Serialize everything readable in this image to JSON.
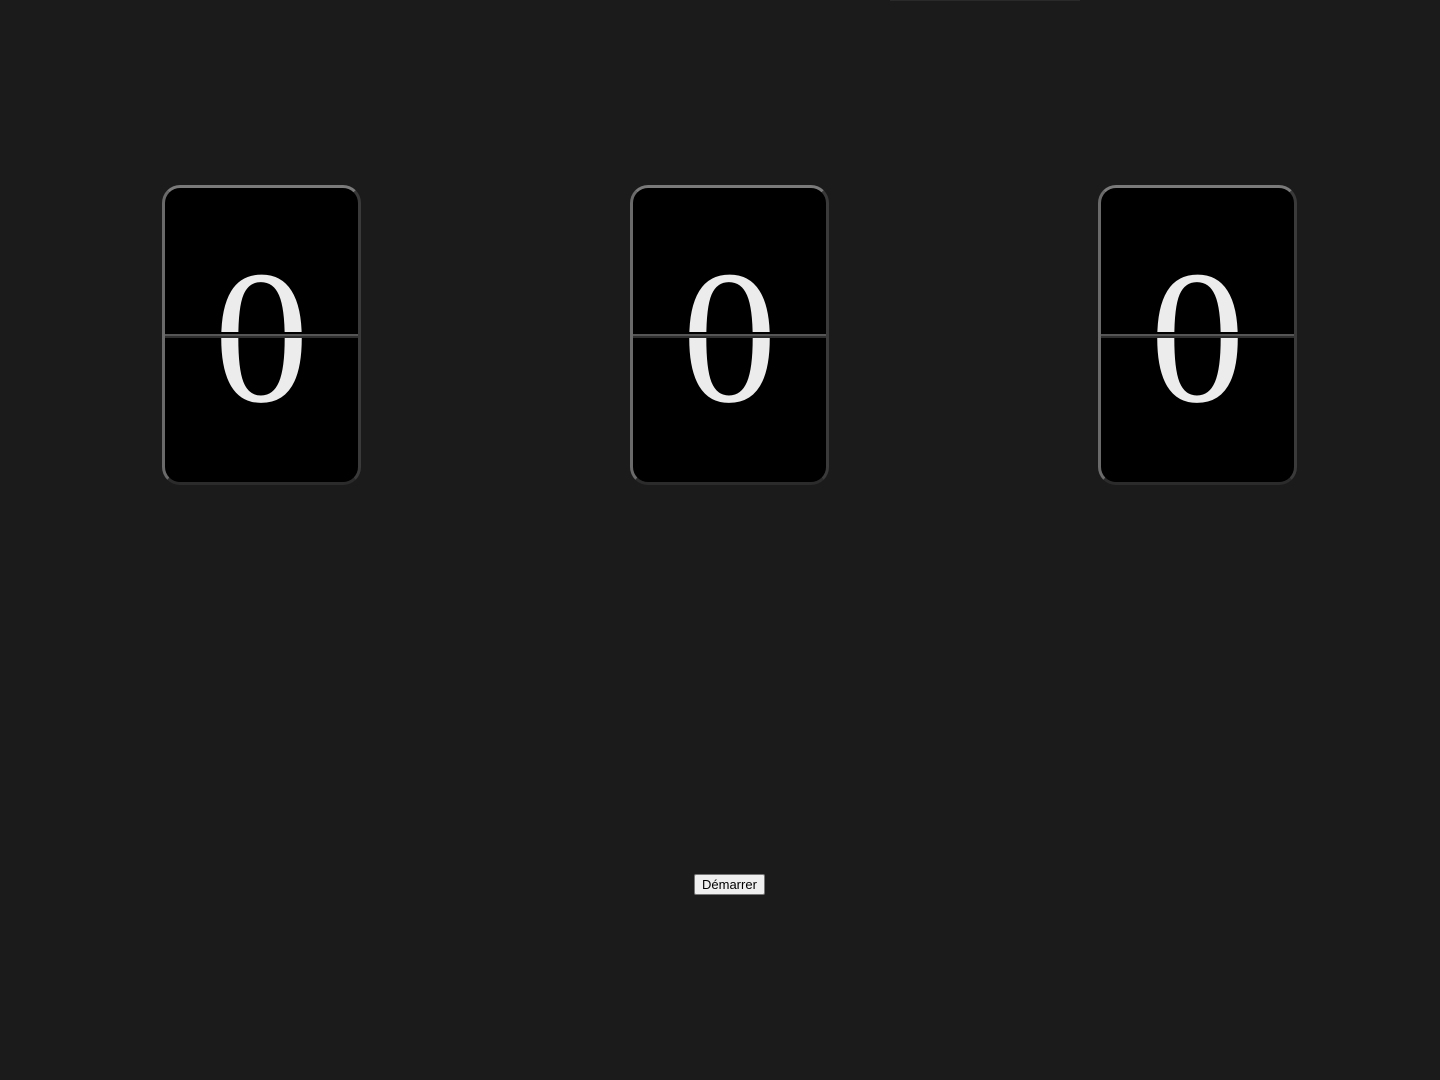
{
  "counter": {
    "digits": [
      "0",
      "0",
      "0"
    ]
  },
  "controls": {
    "start_label": "Démarrer"
  },
  "colors": {
    "background": "#1b1b1b",
    "card": "#000000",
    "digit": "#ececec"
  }
}
